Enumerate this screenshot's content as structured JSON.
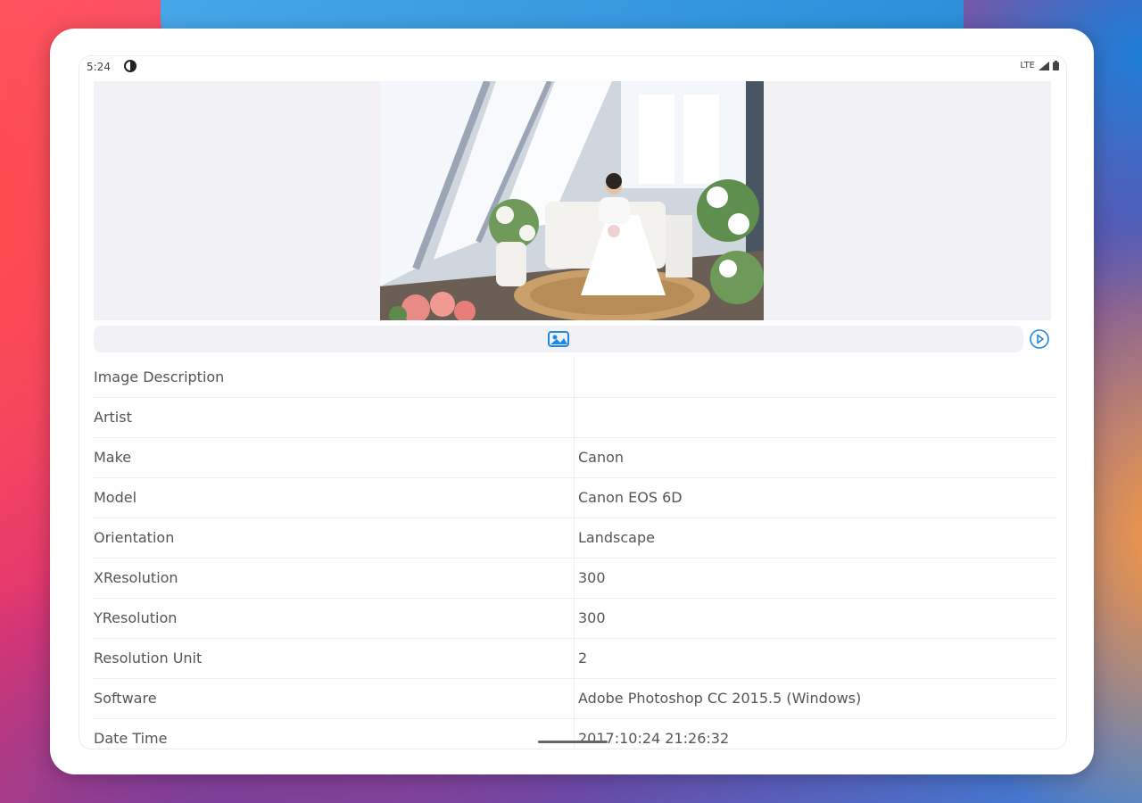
{
  "status": {
    "time": "5:24",
    "network": "LTE"
  },
  "colors": {
    "accent": "#1e88e5",
    "background": "#ffffff",
    "panel": "#f2f2f6",
    "text": "#555555"
  },
  "icons": {
    "status_app": "circle-half-icon",
    "signal": "signal-icon",
    "battery": "battery-icon",
    "image_info": "image-info-icon",
    "play": "play-circle-icon"
  },
  "exif": {
    "rows": [
      {
        "key": "Image Description",
        "value": ""
      },
      {
        "key": "Artist",
        "value": ""
      },
      {
        "key": "Make",
        "value": "Canon"
      },
      {
        "key": "Model",
        "value": "Canon EOS 6D"
      },
      {
        "key": "Orientation",
        "value": "Landscape"
      },
      {
        "key": "XResolution",
        "value": "300"
      },
      {
        "key": "YResolution",
        "value": "300"
      },
      {
        "key": "Resolution Unit",
        "value": "2"
      },
      {
        "key": "Software",
        "value": "Adobe Photoshop CC 2015.5 (Windows)"
      },
      {
        "key": "Date Time",
        "value": "2017:10:24 21:26:32"
      }
    ]
  }
}
